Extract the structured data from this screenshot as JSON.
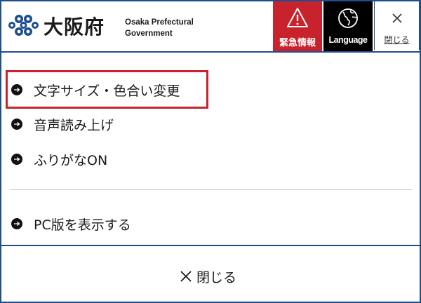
{
  "header": {
    "site_name": "大阪府",
    "site_name_en_line1": "Osaka Prefectural",
    "site_name_en_line2": "Government",
    "emergency_label": "緊急情報",
    "language_label": "Language",
    "close_label": "閉じる"
  },
  "menu": {
    "items": [
      {
        "label": "文字サイズ・色合い変更",
        "icon": "arrow-right-icon"
      },
      {
        "label": "音声読み上げ",
        "icon": "arrow-right-icon"
      },
      {
        "label": "ふりがなON",
        "icon": "arrow-right-icon"
      },
      {
        "label": "PC版を表示する",
        "icon": "arrow-right-icon"
      }
    ]
  },
  "footer": {
    "close_label": "閉じる"
  },
  "colors": {
    "accent_blue": "#1f4e8f",
    "emergency_red": "#c8232c",
    "language_black": "#000000",
    "highlight_red": "#c8232c"
  }
}
